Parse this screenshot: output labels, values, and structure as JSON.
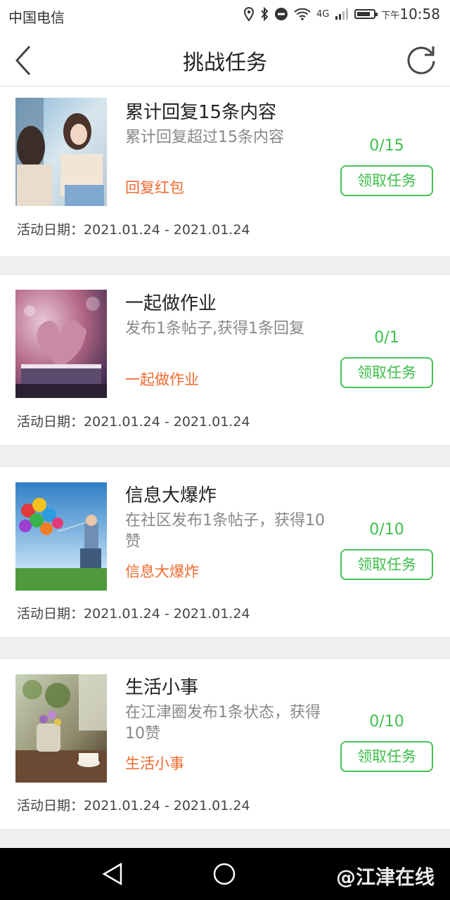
{
  "status_bar": {
    "carrier": "中国电信",
    "network": "4G",
    "time_prefix": "下午",
    "time": "10:58",
    "icons": [
      "location-icon",
      "bluetooth-icon",
      "do-not-disturb-icon",
      "wifi-icon",
      "signal-icon",
      "battery-icon"
    ],
    "battery_level": 0.8
  },
  "header": {
    "title": "挑战任务",
    "back_icon": "chevron-left-icon",
    "refresh_icon": "refresh-icon"
  },
  "tasks": [
    {
      "title": "累计回复15条内容",
      "description": "累计回复超过15条内容",
      "tag": "回复红包",
      "progress": "0/15",
      "button_label": "领取任务",
      "date_label": "活动日期：",
      "date_range": "2021.01.24 - 2021.01.24",
      "image": "two-women-photo"
    },
    {
      "title": "一起做作业",
      "description": "发布1条帖子,获得1条回复",
      "tag": "一起做作业",
      "progress": "0/1",
      "button_label": "领取任务",
      "date_label": "活动日期：",
      "date_range": "2021.01.24 - 2021.01.24",
      "image": "heart-book-photo"
    },
    {
      "title": "信息大爆炸",
      "description": "在社区发布1条帖子，获得10赞",
      "tag": "信息大爆炸",
      "progress": "0/10",
      "button_label": "领取任务",
      "date_label": "活动日期：",
      "date_range": "2021.01.24 - 2021.01.24",
      "image": "balloons-photo"
    },
    {
      "title": "生活小事",
      "description": "在江津圈发布1条状态，获得10赞",
      "tag": "生活小事",
      "progress": "0/10",
      "button_label": "领取任务",
      "date_label": "活动日期：",
      "date_range": "2021.01.24 - 2021.01.24",
      "image": "teapot-flowers-photo"
    }
  ],
  "nav_bar": {
    "icons": [
      "back-triangle-icon",
      "home-circle-icon"
    ],
    "watermark": "@江津在线"
  },
  "colors": {
    "accent_green": "#3dbf4a",
    "tag_orange": "#f06a2e"
  }
}
